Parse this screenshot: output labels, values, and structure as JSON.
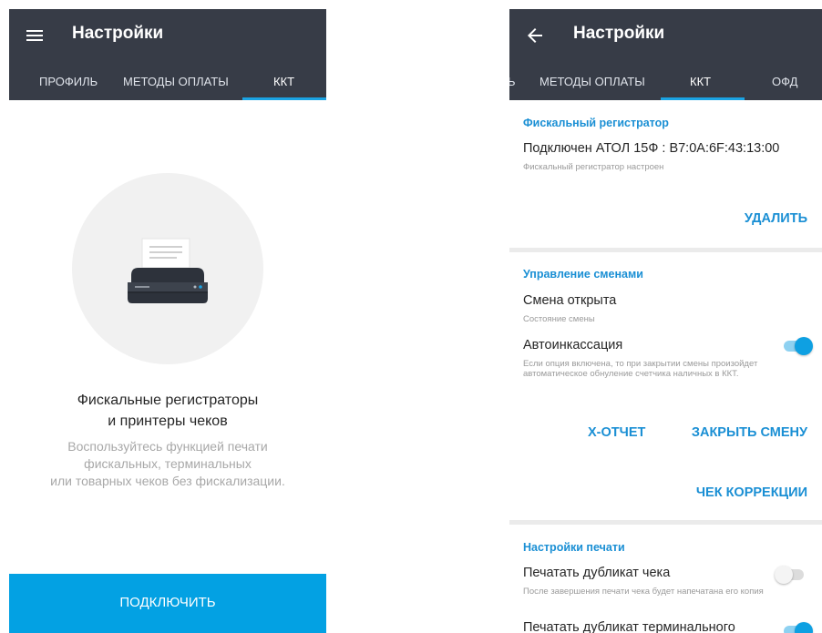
{
  "left": {
    "title": "Настройки",
    "tabs": [
      "ПРОФИЛЬ",
      "МЕТОДЫ ОПЛАТЫ",
      "ККТ"
    ],
    "empty_title": [
      "Фискальные регистраторы",
      "и принтеры чеков"
    ],
    "empty_sub": [
      "Воспользуйтесь функцией печати",
      "фискальных, терминальных",
      "или товарных чеков без фискализации."
    ],
    "connect_label": "ПОДКЛЮЧИТЬ"
  },
  "right": {
    "title": "Настройки",
    "tabs": [
      "ь",
      "МЕТОДЫ ОПЛАТЫ",
      "ККТ",
      "ОФД"
    ],
    "fiscal": {
      "section": "Фискальный регистратор",
      "status": "Подключен АТОЛ 15Ф : B7:0A:6F:43:13:00",
      "status_sub": "Фискальный регистратор настроен",
      "delete_label": "УДАЛИТЬ"
    },
    "shifts": {
      "section": "Управление сменами",
      "shift_status": "Смена открыта",
      "shift_status_sub": "Состояние смены",
      "auto_collect": "Автоинкассация",
      "auto_collect_sub": "Если опция включена, то при закрытии смены произойдет автоматическое обнуление счетчика наличных в ККТ.",
      "auto_collect_on": true,
      "x_report_label": "X-ОТЧЕТ",
      "close_shift_label": "ЗАКРЫТЬ СМЕНУ",
      "correction_label": "ЧЕК КОРРЕКЦИИ"
    },
    "print": {
      "section": "Настройки печати",
      "duplicate": "Печатать дубликат чека",
      "duplicate_sub": "После завершения печати чека будет напечатана его копия",
      "duplicate_on": false,
      "terminal_duplicate": "Печатать дубликат терминального",
      "terminal_duplicate_on": true
    }
  },
  "colors": {
    "appbar": "#373c47",
    "accent": "#03a1e3",
    "link": "#1a8fd4",
    "divider": "#ebebeb"
  },
  "icons": {
    "menu": "hamburger-menu-icon",
    "back": "arrow-back-icon",
    "printer": "fiscal-printer-icon"
  }
}
